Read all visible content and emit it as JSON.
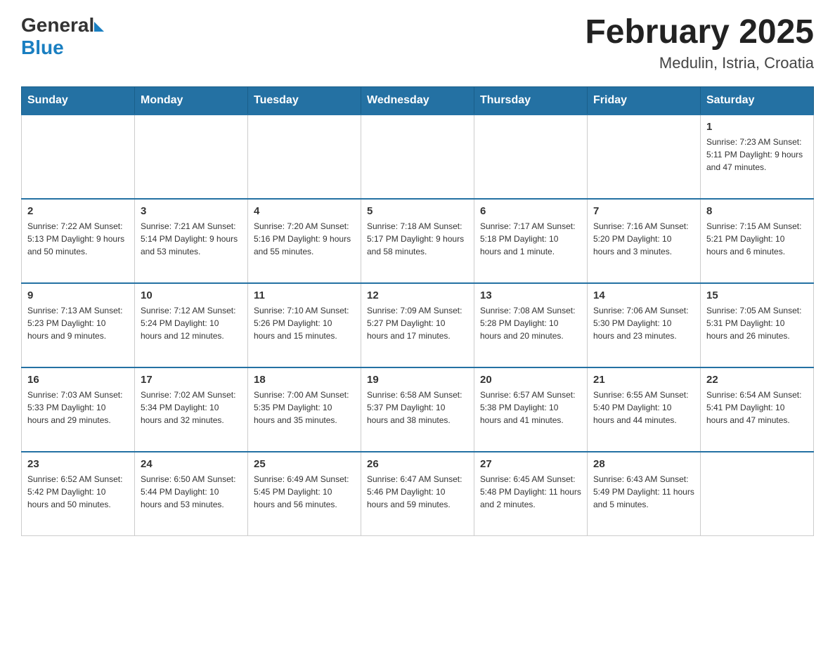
{
  "header": {
    "logo_general": "General",
    "logo_blue": "Blue",
    "month_title": "February 2025",
    "location": "Medulin, Istria, Croatia"
  },
  "days_of_week": [
    "Sunday",
    "Monday",
    "Tuesday",
    "Wednesday",
    "Thursday",
    "Friday",
    "Saturday"
  ],
  "weeks": [
    [
      {
        "day": "",
        "info": ""
      },
      {
        "day": "",
        "info": ""
      },
      {
        "day": "",
        "info": ""
      },
      {
        "day": "",
        "info": ""
      },
      {
        "day": "",
        "info": ""
      },
      {
        "day": "",
        "info": ""
      },
      {
        "day": "1",
        "info": "Sunrise: 7:23 AM\nSunset: 5:11 PM\nDaylight: 9 hours and 47 minutes."
      }
    ],
    [
      {
        "day": "2",
        "info": "Sunrise: 7:22 AM\nSunset: 5:13 PM\nDaylight: 9 hours and 50 minutes."
      },
      {
        "day": "3",
        "info": "Sunrise: 7:21 AM\nSunset: 5:14 PM\nDaylight: 9 hours and 53 minutes."
      },
      {
        "day": "4",
        "info": "Sunrise: 7:20 AM\nSunset: 5:16 PM\nDaylight: 9 hours and 55 minutes."
      },
      {
        "day": "5",
        "info": "Sunrise: 7:18 AM\nSunset: 5:17 PM\nDaylight: 9 hours and 58 minutes."
      },
      {
        "day": "6",
        "info": "Sunrise: 7:17 AM\nSunset: 5:18 PM\nDaylight: 10 hours and 1 minute."
      },
      {
        "day": "7",
        "info": "Sunrise: 7:16 AM\nSunset: 5:20 PM\nDaylight: 10 hours and 3 minutes."
      },
      {
        "day": "8",
        "info": "Sunrise: 7:15 AM\nSunset: 5:21 PM\nDaylight: 10 hours and 6 minutes."
      }
    ],
    [
      {
        "day": "9",
        "info": "Sunrise: 7:13 AM\nSunset: 5:23 PM\nDaylight: 10 hours and 9 minutes."
      },
      {
        "day": "10",
        "info": "Sunrise: 7:12 AM\nSunset: 5:24 PM\nDaylight: 10 hours and 12 minutes."
      },
      {
        "day": "11",
        "info": "Sunrise: 7:10 AM\nSunset: 5:26 PM\nDaylight: 10 hours and 15 minutes."
      },
      {
        "day": "12",
        "info": "Sunrise: 7:09 AM\nSunset: 5:27 PM\nDaylight: 10 hours and 17 minutes."
      },
      {
        "day": "13",
        "info": "Sunrise: 7:08 AM\nSunset: 5:28 PM\nDaylight: 10 hours and 20 minutes."
      },
      {
        "day": "14",
        "info": "Sunrise: 7:06 AM\nSunset: 5:30 PM\nDaylight: 10 hours and 23 minutes."
      },
      {
        "day": "15",
        "info": "Sunrise: 7:05 AM\nSunset: 5:31 PM\nDaylight: 10 hours and 26 minutes."
      }
    ],
    [
      {
        "day": "16",
        "info": "Sunrise: 7:03 AM\nSunset: 5:33 PM\nDaylight: 10 hours and 29 minutes."
      },
      {
        "day": "17",
        "info": "Sunrise: 7:02 AM\nSunset: 5:34 PM\nDaylight: 10 hours and 32 minutes."
      },
      {
        "day": "18",
        "info": "Sunrise: 7:00 AM\nSunset: 5:35 PM\nDaylight: 10 hours and 35 minutes."
      },
      {
        "day": "19",
        "info": "Sunrise: 6:58 AM\nSunset: 5:37 PM\nDaylight: 10 hours and 38 minutes."
      },
      {
        "day": "20",
        "info": "Sunrise: 6:57 AM\nSunset: 5:38 PM\nDaylight: 10 hours and 41 minutes."
      },
      {
        "day": "21",
        "info": "Sunrise: 6:55 AM\nSunset: 5:40 PM\nDaylight: 10 hours and 44 minutes."
      },
      {
        "day": "22",
        "info": "Sunrise: 6:54 AM\nSunset: 5:41 PM\nDaylight: 10 hours and 47 minutes."
      }
    ],
    [
      {
        "day": "23",
        "info": "Sunrise: 6:52 AM\nSunset: 5:42 PM\nDaylight: 10 hours and 50 minutes."
      },
      {
        "day": "24",
        "info": "Sunrise: 6:50 AM\nSunset: 5:44 PM\nDaylight: 10 hours and 53 minutes."
      },
      {
        "day": "25",
        "info": "Sunrise: 6:49 AM\nSunset: 5:45 PM\nDaylight: 10 hours and 56 minutes."
      },
      {
        "day": "26",
        "info": "Sunrise: 6:47 AM\nSunset: 5:46 PM\nDaylight: 10 hours and 59 minutes."
      },
      {
        "day": "27",
        "info": "Sunrise: 6:45 AM\nSunset: 5:48 PM\nDaylight: 11 hours and 2 minutes."
      },
      {
        "day": "28",
        "info": "Sunrise: 6:43 AM\nSunset: 5:49 PM\nDaylight: 11 hours and 5 minutes."
      },
      {
        "day": "",
        "info": ""
      }
    ]
  ]
}
